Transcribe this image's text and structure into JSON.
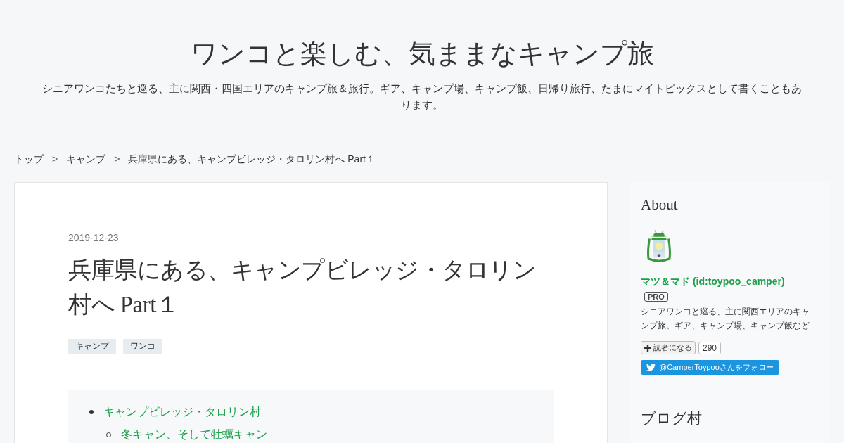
{
  "blog": {
    "title": "ワンコと楽しむ、気ままなキャンプ旅",
    "description": "シニアワンコたちと巡る、主に関西・四国エリアのキャンプ旅＆旅行。ギア、キャンプ場、キャンプ飯、日帰り旅行、たまにマイトピックスとして書くこともあります。"
  },
  "breadcrumb": [
    {
      "label": "トップ",
      "kind": "link"
    },
    {
      "label": ">",
      "kind": "separator"
    },
    {
      "label": "キャンプ",
      "kind": "link"
    },
    {
      "label": ">",
      "kind": "separator"
    },
    {
      "label": "兵庫県にある、キャンプビレッジ・タロリン村へ Part１",
      "kind": "current"
    }
  ],
  "article": {
    "date": "2019-12-23",
    "title": "兵庫県にある、キャンプビレッジ・タロリン村へ Part１",
    "tags": [
      "キャンプ",
      "ワンコ"
    ],
    "toc": [
      {
        "label": "キャンプビレッジ・タロリン村",
        "children": [
          {
            "label": "冬キャン、そして牡蠣キャン"
          }
        ]
      }
    ]
  },
  "sidebar": {
    "about": {
      "heading": "About",
      "name": "マツ＆マド (id:toypoo_camper)",
      "badge": "PRO",
      "description": "シニアワンコと巡る、主に関西エリアのキャンプ旅。ギア、キャンプ場、キャンプ飯など",
      "subscribe": "読者になる",
      "subscribers": "290",
      "twitter": "@CamperToypooさんをフォロー"
    },
    "next_heading": "ブログ村"
  }
}
